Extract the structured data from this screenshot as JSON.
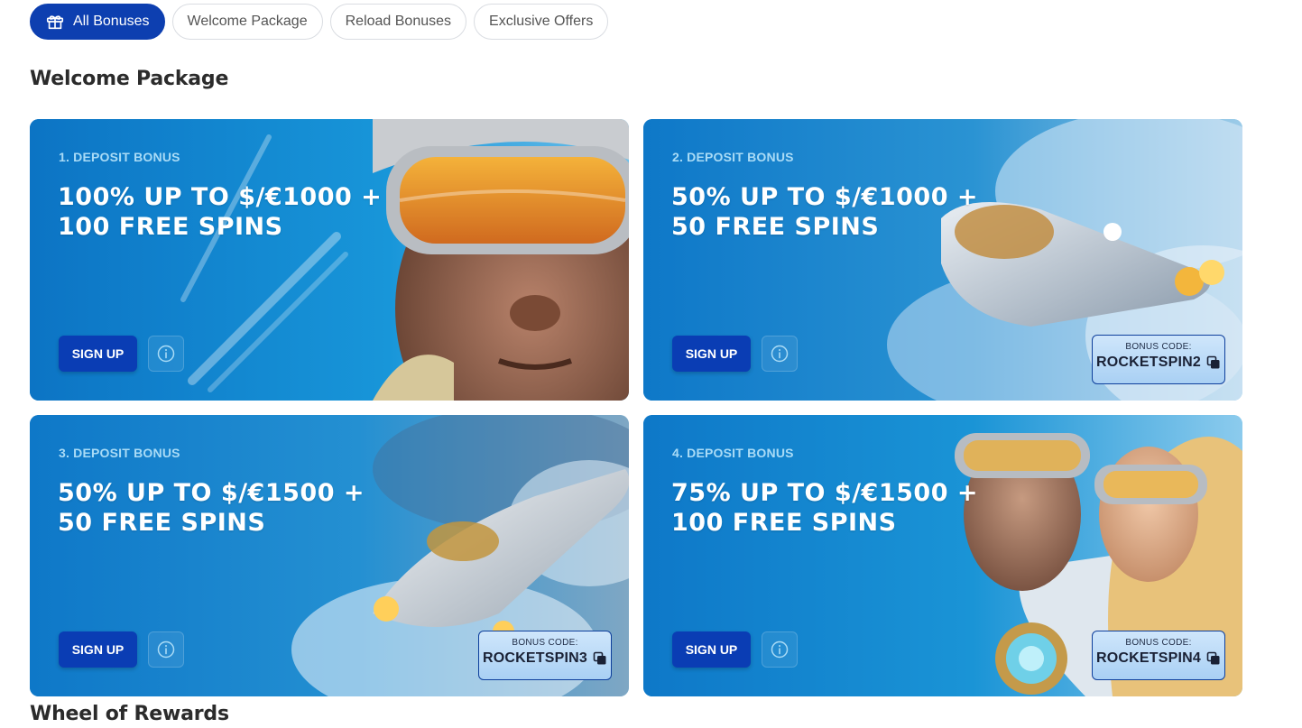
{
  "tabs": [
    {
      "label": "All Bonuses",
      "active": true,
      "icon": "gift-icon"
    },
    {
      "label": "Welcome Package",
      "active": false
    },
    {
      "label": "Reload Bonuses",
      "active": false
    },
    {
      "label": "Exclusive Offers",
      "active": false
    }
  ],
  "sections": {
    "welcome_title": "Welcome Package",
    "wheel_title": "Wheel of Rewards"
  },
  "cards": [
    {
      "label": "1. DEPOSIT BONUS",
      "headline": "100% UP TO $/€1000 + 100 FREE SPINS",
      "signup": "SIGN UP"
    },
    {
      "label": "2. DEPOSIT BONUS",
      "headline": "50% UP TO $/€1000 + 50 FREE SPINS",
      "signup": "SIGN UP",
      "code_label": "BONUS CODE:",
      "code": "ROCKETSPIN2"
    },
    {
      "label": "3. DEPOSIT BONUS",
      "headline": "50% UP TO $/€1500 + 50 FREE SPINS",
      "signup": "SIGN UP",
      "code_label": "BONUS CODE:",
      "code": "ROCKETSPIN3"
    },
    {
      "label": "4. DEPOSIT BONUS",
      "headline": "75% UP TO $/€1500 + 100 FREE SPINS",
      "signup": "SIGN UP",
      "code_label": "BONUS CODE:",
      "code": "ROCKETSPIN4"
    }
  ],
  "colors": {
    "primary": "#0d3fb0",
    "card_bg": "#1592d8",
    "code_border": "#0e3f9c"
  }
}
